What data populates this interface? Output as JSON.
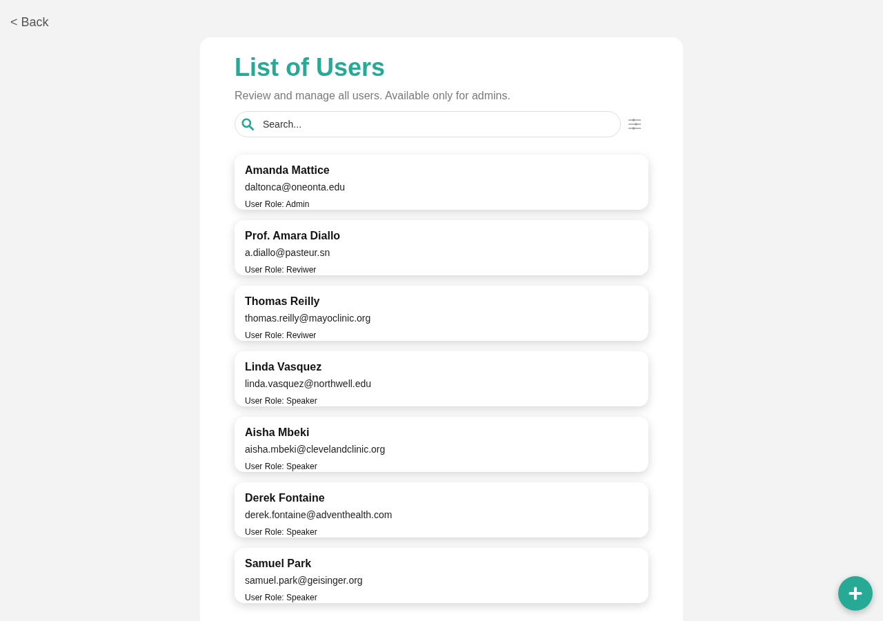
{
  "back_link": {
    "label": "< Back"
  },
  "page": {
    "title": "List of Users",
    "subtitle": "Review and manage all users. Available only for admins."
  },
  "search": {
    "placeholder": "Search..."
  },
  "users": [
    {
      "name": "Amanda Mattice",
      "email": "daltonca@oneonta.edu",
      "role": "User Role: Admin"
    },
    {
      "name": "Prof. Amara Diallo",
      "email": "a.diallo@pasteur.sn",
      "role": "User Role: Reviwer"
    },
    {
      "name": "Thomas Reilly",
      "email": "thomas.reilly@mayoclinic.org",
      "role": "User Role: Reviwer"
    },
    {
      "name": "Linda Vasquez",
      "email": "linda.vasquez@northwell.edu",
      "role": "User Role: Speaker"
    },
    {
      "name": "Aisha Mbeki",
      "email": "aisha.mbeki@clevelandclinic.org",
      "role": "User Role: Speaker"
    },
    {
      "name": "Derek Fontaine",
      "email": "derek.fontaine@adventhealth.com",
      "role": "User Role: Speaker"
    },
    {
      "name": "Samuel Park",
      "email": "samuel.park@geisinger.org",
      "role": "User Role: Speaker"
    }
  ]
}
